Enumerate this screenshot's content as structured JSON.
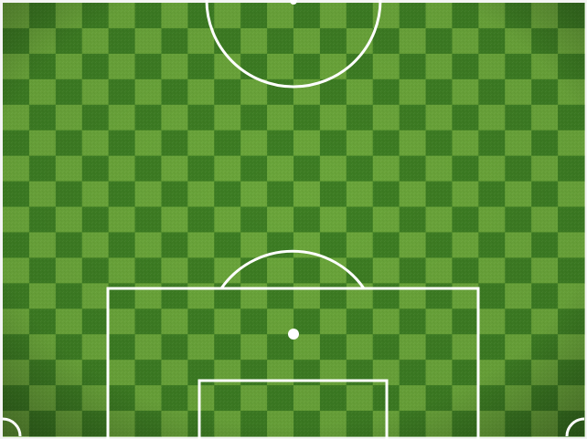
{
  "pitch": {
    "colors": {
      "light": "#6aa53a",
      "dark": "#3d7d23",
      "lines": "#ffffff",
      "frame": "#f4f4f4"
    },
    "grid": {
      "columns": 22,
      "rows": 17
    },
    "half": "lower-half-of-field"
  }
}
